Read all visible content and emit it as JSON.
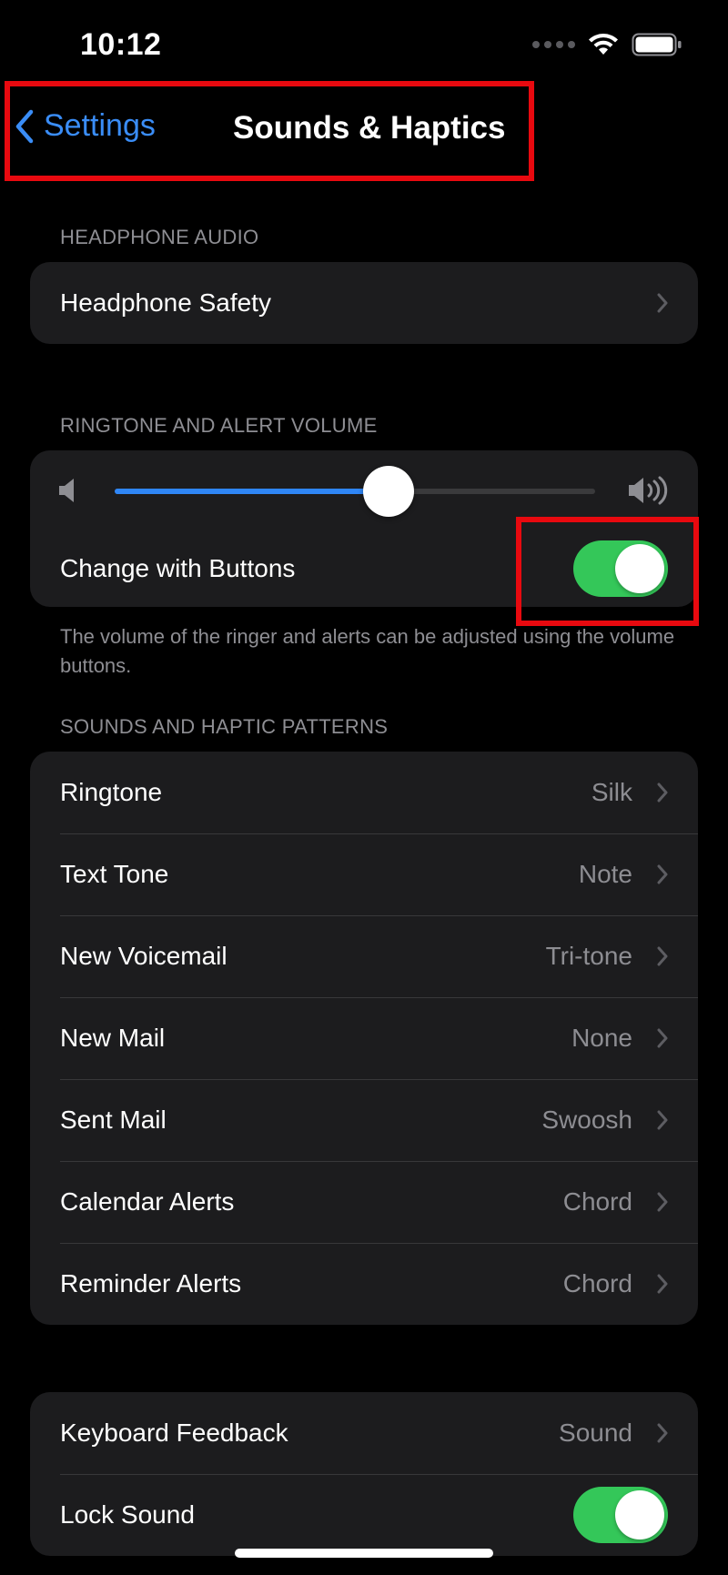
{
  "status_bar": {
    "time": "10:12"
  },
  "nav": {
    "back_label": "Settings",
    "title": "Sounds & Haptics"
  },
  "headphone_audio": {
    "header": "HEADPHONE AUDIO",
    "rows": [
      {
        "label": "Headphone Safety"
      }
    ]
  },
  "ringtone_volume": {
    "header": "RINGTONE AND ALERT VOLUME",
    "slider_level": 0.57,
    "change_with_buttons": {
      "label": "Change with Buttons",
      "on": true
    },
    "footer": "The volume of the ringer and alerts can be adjusted using the volume buttons."
  },
  "patterns": {
    "header": "SOUNDS AND HAPTIC PATTERNS",
    "rows": [
      {
        "label": "Ringtone",
        "value": "Silk"
      },
      {
        "label": "Text Tone",
        "value": "Note"
      },
      {
        "label": "New Voicemail",
        "value": "Tri-tone"
      },
      {
        "label": "New Mail",
        "value": "None"
      },
      {
        "label": "Sent Mail",
        "value": "Swoosh"
      },
      {
        "label": "Calendar Alerts",
        "value": "Chord"
      },
      {
        "label": "Reminder Alerts",
        "value": "Chord"
      }
    ]
  },
  "feedback": {
    "rows": [
      {
        "label": "Keyboard Feedback",
        "value": "Sound"
      },
      {
        "label": "Lock Sound",
        "on": true
      }
    ]
  },
  "colors": {
    "accent": "#3a8df7",
    "toggle_on": "#34c759",
    "highlight": "#e8090f",
    "cell_background": "#1c1c1e"
  }
}
